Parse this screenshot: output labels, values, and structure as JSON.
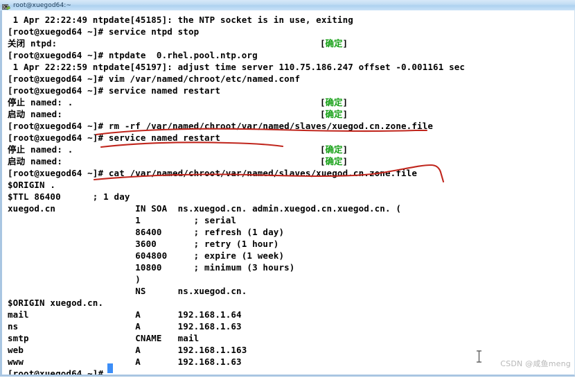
{
  "window": {
    "title": "root@xuegod64:~",
    "icon": "putty-terminal-icon"
  },
  "terminal": {
    "prompt": "[root@xuegod64 ~]#",
    "ok_label": "[确定]",
    "ok_label_open": "[",
    "ok_label_text": "确定",
    "ok_label_close": "]",
    "lines": [
      {
        "text": " 1 Apr 22:22:49 ntpdate[45185]: the NTP socket is in use, exiting"
      },
      {
        "text": "[root@xuegod64 ~]# service ntpd stop"
      },
      {
        "text": "关闭 ntpd:"
      },
      {
        "text": "[root@xuegod64 ~]# ntpdate  0.rhel.pool.ntp.org"
      },
      {
        "text": " 1 Apr 22:22:59 ntpdate[45197]: adjust time server 110.75.186.247 offset -0.001161 sec"
      },
      {
        "text": "[root@xuegod64 ~]# vim /var/named/chroot/etc/named.conf"
      },
      {
        "text": "[root@xuegod64 ~]# service named restart"
      },
      {
        "text": "停止 named: ."
      },
      {
        "text": "启动 named:"
      },
      {
        "text": "[root@xuegod64 ~]# rm -rf /var/named/chroot/var/named/slaves/xuegod.cn.zone.file"
      },
      {
        "text": "[root@xuegod64 ~]# service named restart"
      },
      {
        "text": "停止 named: ."
      },
      {
        "text": "启动 named:"
      },
      {
        "text": "[root@xuegod64 ~]# cat /var/named/chroot/var/named/slaves/xuegod.cn.zone.file"
      },
      {
        "text": "$ORIGIN ."
      },
      {
        "text": "$TTL 86400      ; 1 day"
      },
      {
        "text": "xuegod.cn               IN SOA  ns.xuegod.cn. admin.xuegod.cn.xuegod.cn. ("
      },
      {
        "text": "                        1          ; serial"
      },
      {
        "text": "                        86400      ; refresh (1 day)"
      },
      {
        "text": "                        3600       ; retry (1 hour)"
      },
      {
        "text": "                        604800     ; expire (1 week)"
      },
      {
        "text": "                        10800      ; minimum (3 hours)"
      },
      {
        "text": "                        )"
      },
      {
        "text": "                        NS      ns.xuegod.cn."
      },
      {
        "text": "$ORIGIN xuegod.cn."
      },
      {
        "text": "mail                    A       192.168.1.64"
      },
      {
        "text": "ns                      A       192.168.1.63"
      },
      {
        "text": "smtp                    CNAME   mail"
      },
      {
        "text": "web                     A       192.168.1.163"
      },
      {
        "text": "www                     A       192.168.1.63"
      },
      {
        "text": "[root@xuegod64 ~]#"
      }
    ],
    "ok_badges": [
      {
        "line": 2,
        "label": "[确定]"
      },
      {
        "line": 7,
        "label": "[确定]"
      },
      {
        "line": 8,
        "label": "[确定]"
      },
      {
        "line": 11,
        "label": "[确定]"
      },
      {
        "line": 12,
        "label": "[确定]"
      }
    ],
    "zone_records": [
      {
        "name": "mail",
        "type": "A",
        "value": "192.168.1.64"
      },
      {
        "name": "ns",
        "type": "A",
        "value": "192.168.1.63"
      },
      {
        "name": "smtp",
        "type": "CNAME",
        "value": "mail"
      },
      {
        "name": "web",
        "type": "A",
        "value": "192.168.1.163"
      },
      {
        "name": "www",
        "type": "A",
        "value": "192.168.1.63"
      }
    ],
    "soa": {
      "origin": "$ORIGIN .",
      "ttl": "$TTL 86400",
      "ttl_comment": "; 1 day",
      "zone": "xuegod.cn",
      "class": "IN",
      "type": "SOA",
      "mname": "ns.xuegod.cn.",
      "rname": "admin.xuegod.cn.xuegod.cn.",
      "serial": "1",
      "refresh": "86400",
      "refresh_comment": "; refresh (1 day)",
      "retry": "3600",
      "retry_comment": "; retry (1 hour)",
      "expire": "604800",
      "expire_comment": "; expire (1 week)",
      "minimum": "10800",
      "minimum_comment": "; minimum (3 hours)",
      "ns": "ns.xuegod.cn.",
      "origin2": "$ORIGIN xuegod.cn."
    }
  },
  "annotations": {
    "color": "#c0261d",
    "marks": [
      {
        "name": "underline-rm-command"
      },
      {
        "name": "underline-service-named-restart"
      },
      {
        "name": "underline-cat-command-with-hook"
      }
    ]
  },
  "watermark": {
    "text": "CSDN @咸鱼meng"
  },
  "colors": {
    "terminal_bg": "#ffffff",
    "terminal_fg": "#000000",
    "ok_green": "#16a016",
    "annotation_red": "#c0261d",
    "cursor_blue": "#3d8ef7",
    "titlebar_blue": "#aed2f0"
  }
}
